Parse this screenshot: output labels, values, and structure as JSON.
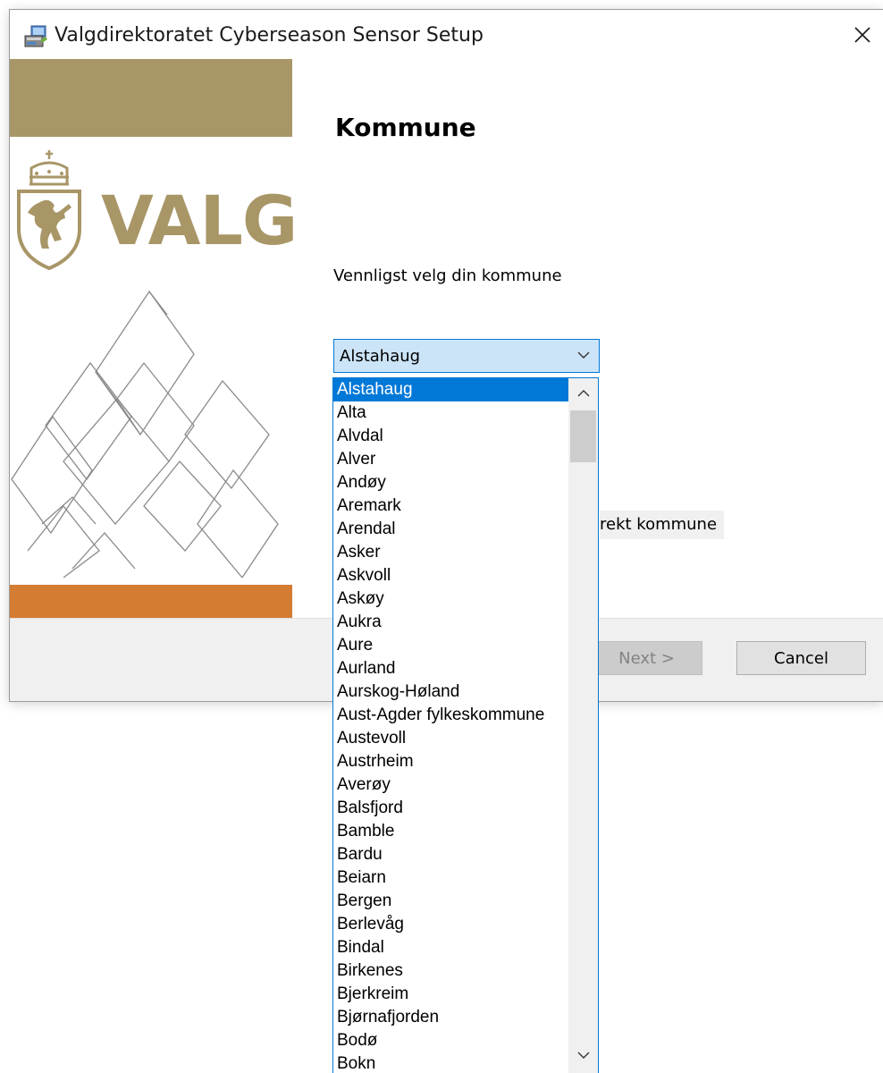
{
  "window": {
    "title": "Valgdirektoratet Cyberseason Sensor Setup",
    "close_icon": "close-icon"
  },
  "banner": {
    "logo_word": "VALG",
    "colors": {
      "gold": "#a89667",
      "orange": "#d57c33"
    }
  },
  "main": {
    "heading": "Kommune",
    "prompt": "Vennligst velg din kommune",
    "combo": {
      "selected": "Alstahaug"
    },
    "partial_label": "rekt kommune"
  },
  "dropdown": {
    "items": [
      {
        "label": "Alstahaug"
      },
      {
        "label": "Alta"
      },
      {
        "label": "Alvdal"
      },
      {
        "label": "Alver"
      },
      {
        "label": "Andøy"
      },
      {
        "label": "Aremark"
      },
      {
        "label": "Arendal"
      },
      {
        "label": "Asker"
      },
      {
        "label": "Askvoll"
      },
      {
        "label": "Askøy"
      },
      {
        "label": "Aukra"
      },
      {
        "label": "Aure"
      },
      {
        "label": "Aurland"
      },
      {
        "label": "Aurskog-Høland"
      },
      {
        "label": "Aust-Agder fylkeskommune"
      },
      {
        "label": "Austevoll"
      },
      {
        "label": "Austrheim"
      },
      {
        "label": "Averøy"
      },
      {
        "label": "Balsfjord"
      },
      {
        "label": "Bamble"
      },
      {
        "label": "Bardu"
      },
      {
        "label": "Beiarn"
      },
      {
        "label": "Bergen"
      },
      {
        "label": "Berlevåg"
      },
      {
        "label": "Bindal"
      },
      {
        "label": "Birkenes"
      },
      {
        "label": "Bjerkreim"
      },
      {
        "label": "Bjørnafjorden"
      },
      {
        "label": "Bodø"
      },
      {
        "label": "Bokn"
      }
    ],
    "selected_index": 0
  },
  "footer": {
    "next_label": "Next >",
    "cancel_label": "Cancel"
  },
  "colors": {
    "selection": "#0078d7",
    "combo_bg": "#cce4f7",
    "footer_bg": "#f0f0f0"
  }
}
